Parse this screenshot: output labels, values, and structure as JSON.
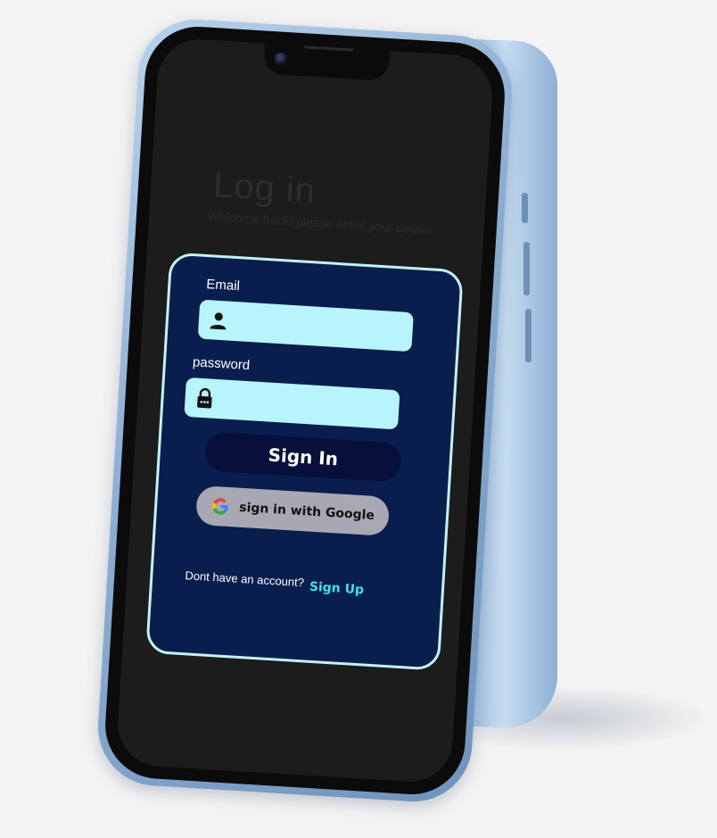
{
  "screen": {
    "title": "Log in",
    "subtitle": "Welcome back! please enter your details"
  },
  "form": {
    "email_label": "Email",
    "email_value": "",
    "password_label": "password",
    "password_value": "",
    "signin_label": "Sign In",
    "google_label": "sign in with Google",
    "footer_text": "Dont have an account?",
    "signup_label": "Sign Up"
  },
  "colors": {
    "card_background": "#0a1e4e",
    "card_border": "#c3f2f5",
    "input_background": "#b8f4fb",
    "signin_button": "#06103a",
    "google_button": "#a8a8b4",
    "link_accent": "#3ee0ea",
    "screen_background": "#1c1c1c",
    "phone_body": "#8fb0d4"
  },
  "icons": {
    "email_field": "user-icon",
    "password_field": "lock-icon",
    "google_button": "google-logo-icon"
  }
}
